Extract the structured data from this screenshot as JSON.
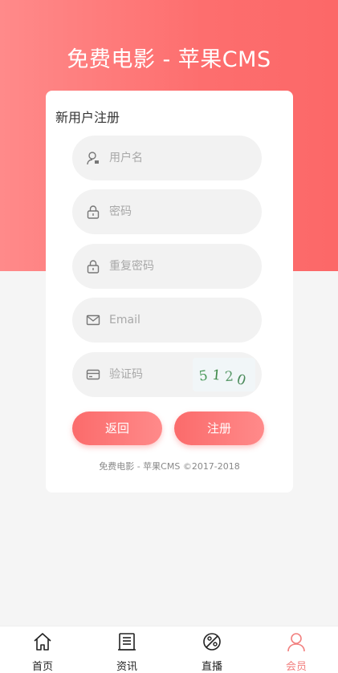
{
  "header": {
    "title": "免费电影 - 苹果CMS"
  },
  "form": {
    "title": "新用户注册",
    "fields": [
      {
        "icon": "user-icon",
        "placeholder": "用户名"
      },
      {
        "icon": "lock-icon",
        "placeholder": "密码"
      },
      {
        "icon": "lock-icon",
        "placeholder": "重复密码"
      },
      {
        "icon": "mail-icon",
        "placeholder": "Email"
      },
      {
        "icon": "card-icon",
        "placeholder": "验证码"
      }
    ],
    "captcha_text": "5120",
    "back_label": "返回",
    "register_label": "注册",
    "footer": "免费电影 - 苹果CMS  ©2017-2018"
  },
  "tabbar": {
    "items": [
      {
        "label": "首页",
        "icon": "home-icon"
      },
      {
        "label": "资讯",
        "icon": "news-icon"
      },
      {
        "label": "直播",
        "icon": "live-icon"
      },
      {
        "label": "会员",
        "icon": "member-icon",
        "active": true
      }
    ]
  },
  "colors": {
    "primary": "#fc6868",
    "primary_light": "#ff8a8a",
    "active_tab": "#f2807f",
    "background": "#f5f5f5"
  }
}
